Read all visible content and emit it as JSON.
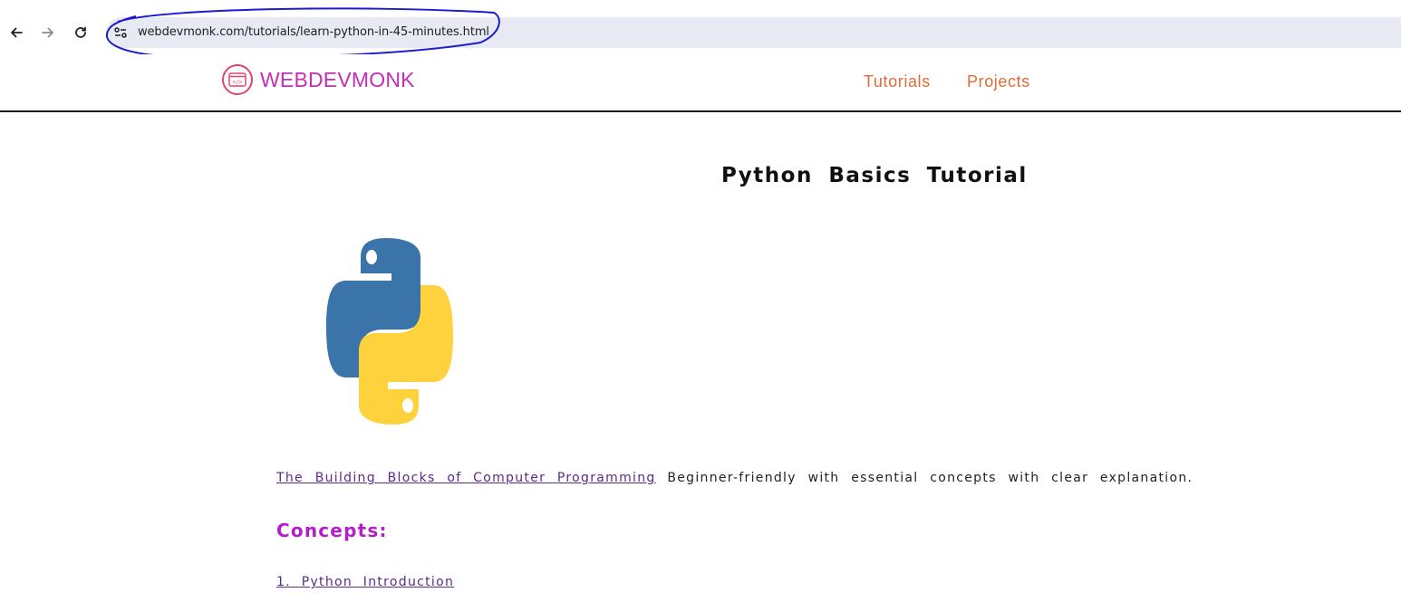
{
  "browser": {
    "url": "webdevmonk.com/tutorials/learn-python-in-45-minutes.html",
    "back_icon": "arrow-left-icon",
    "forward_icon": "arrow-right-icon",
    "reload_icon": "reload-icon",
    "site_info_icon": "tune-icon"
  },
  "site": {
    "logo_text": "WEBDEVMONK",
    "logo_icon": "code-window-icon",
    "nav": [
      "Tutorials",
      "Projects"
    ],
    "colors": {
      "logo": "#c42fb3",
      "nav": "#e06a3a",
      "heading": "#b21fc9",
      "link": "#5b2a86"
    }
  },
  "main": {
    "title": "Python Basics Tutorial",
    "hero_icon": "python-logo",
    "intro_link": "The Building Blocks of Computer Programming",
    "intro_text": " Beginner-friendly with essential concepts with clear explanation.",
    "concepts_heading": "Concepts:",
    "lessons": [
      "1. Python Introduction"
    ]
  }
}
